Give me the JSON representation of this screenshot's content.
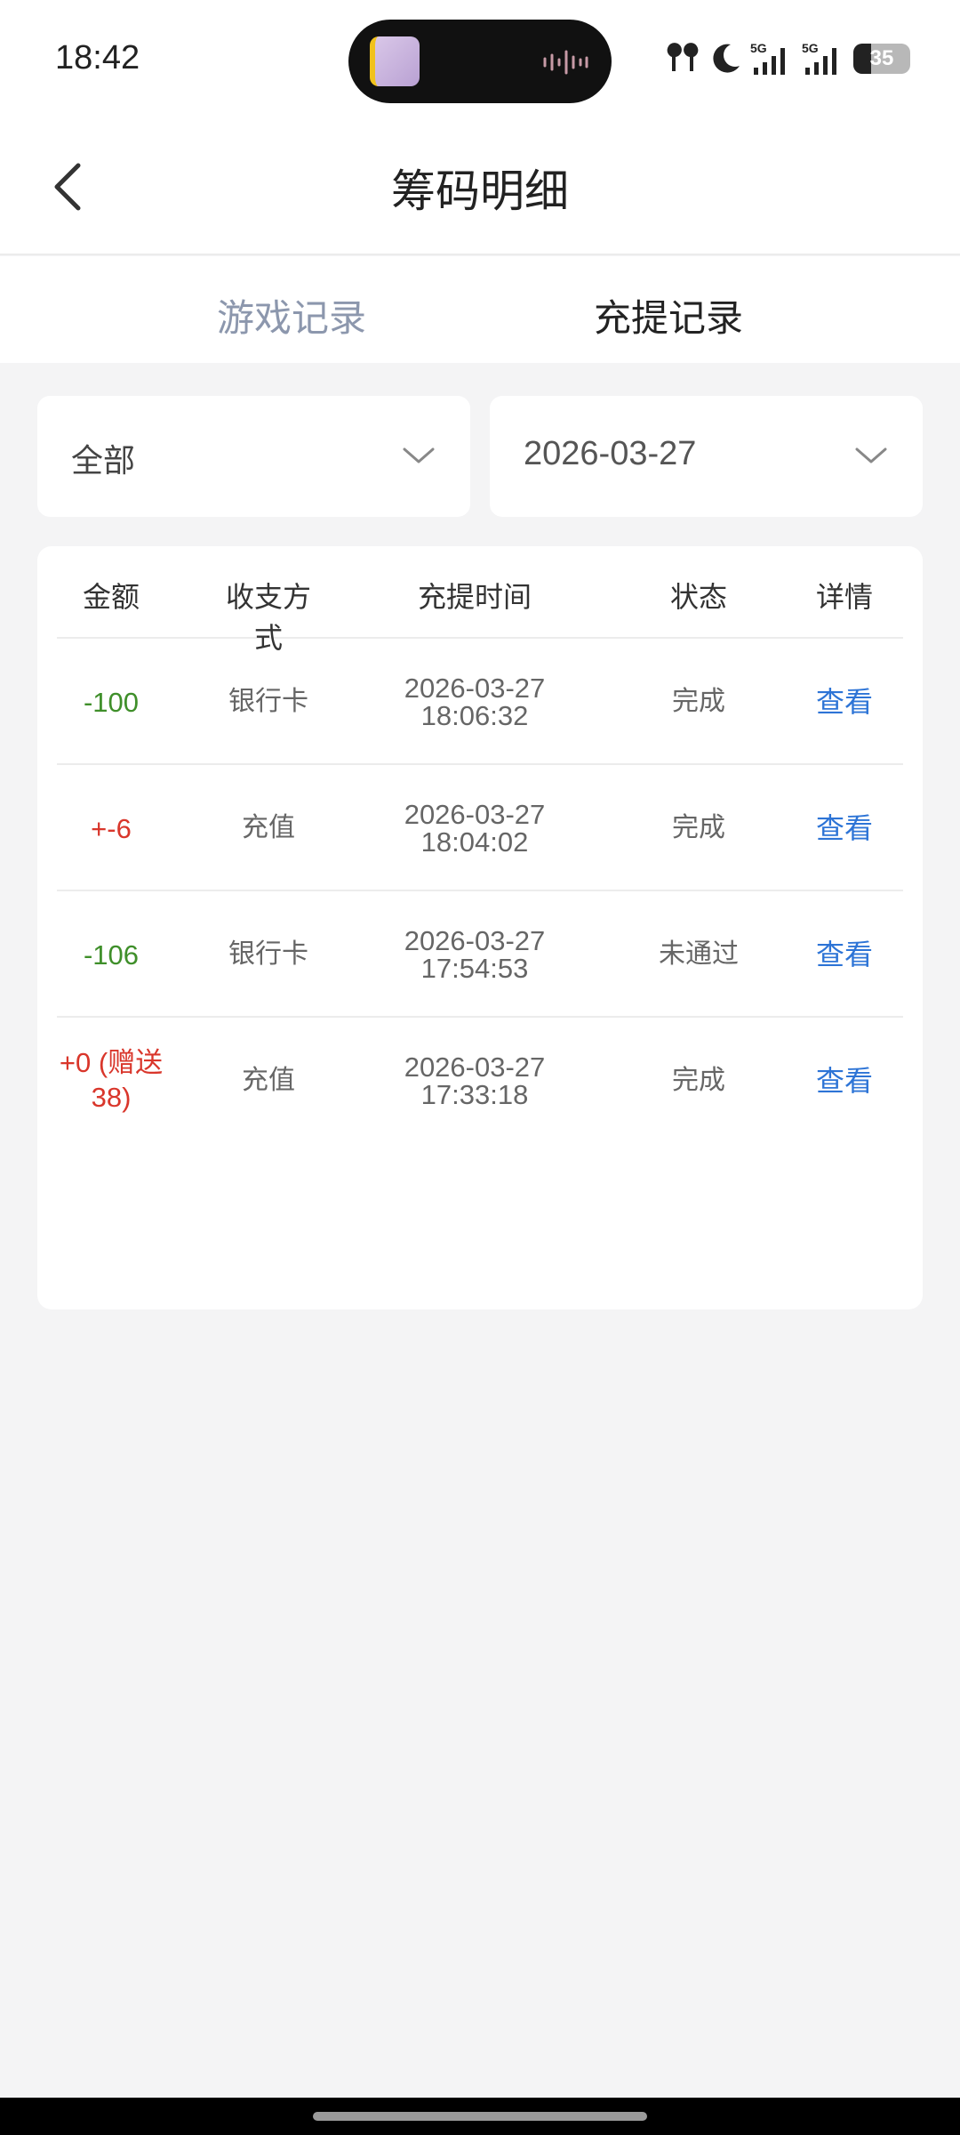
{
  "status_bar": {
    "time": "18:42",
    "network_1": "5G",
    "network_2": "5G",
    "battery": "35",
    "icons": [
      "earbuds-icon",
      "moon-icon",
      "signal-icon",
      "signal-icon",
      "battery-icon"
    ]
  },
  "header": {
    "title": "筹码明细",
    "back_icon": "chevron-left-icon"
  },
  "tabs": [
    {
      "label": "游戏记录",
      "active": false
    },
    {
      "label": "充提记录",
      "active": true
    }
  ],
  "filters": {
    "type_value": "全部",
    "date_value": "2026-03-27"
  },
  "table": {
    "headers": [
      "金额",
      "收支方式",
      "充提时间",
      "状态",
      "详情"
    ],
    "rows": [
      {
        "amount": "-100",
        "amount_color": "#3f8f2a",
        "method": "银行卡",
        "date": "2026-03-27",
        "time": "18:06:32",
        "status": "完成",
        "detail": "查看"
      },
      {
        "amount": "+-6",
        "amount_color": "#d9362b",
        "method": "充值",
        "date": "2026-03-27",
        "time": "18:04:02",
        "status": "完成",
        "detail": "查看"
      },
      {
        "amount": "-106",
        "amount_color": "#3f8f2a",
        "method": "银行卡",
        "date": "2026-03-27",
        "time": "17:54:53",
        "status": "未通过",
        "detail": "查看"
      },
      {
        "amount": "+0 (赠送38)",
        "amount_color": "#d9362b",
        "method": "充值",
        "date": "2026-03-27",
        "time": "17:33:18",
        "status": "完成",
        "detail": "查看"
      }
    ]
  },
  "colors": {
    "link": "#2d74d6",
    "negative": "#3f8f2a",
    "positive": "#d9362b",
    "inactive_tab": "#8c97ad"
  }
}
